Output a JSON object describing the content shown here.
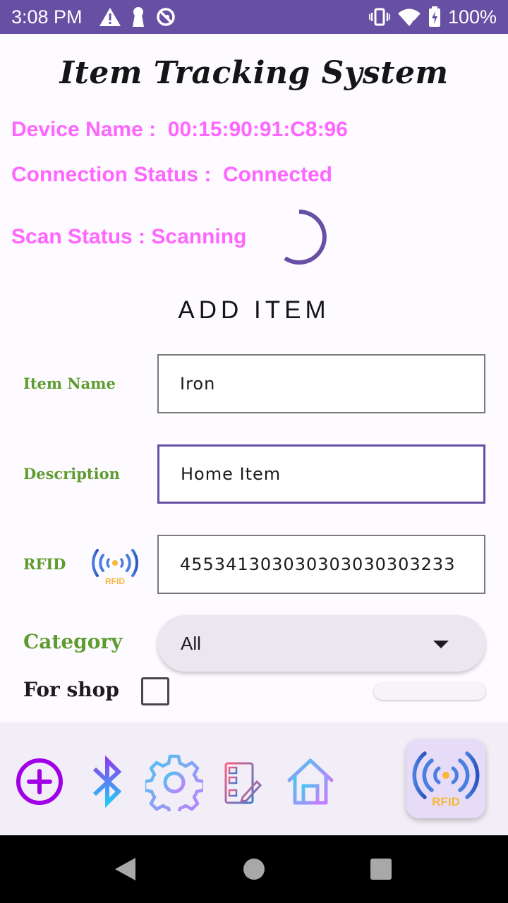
{
  "status_bar": {
    "time": "3:08 PM",
    "battery": "100%",
    "left_icons": [
      "warning-icon",
      "keyhole-icon",
      "sync-off-icon"
    ],
    "right_icons": [
      "vibrate-icon",
      "wifi-icon",
      "battery-icon"
    ]
  },
  "header": {
    "title": "Item Tracking System"
  },
  "device": {
    "name_line": "Device Name :  00:15:90:91:C8:96",
    "connection_line": "Connection Status :  Connected",
    "scan_line": "Scan Status : Scanning"
  },
  "form": {
    "section_title": "ADD ITEM",
    "item_name_label": "Item Name",
    "item_name_value": "Iron",
    "description_label": "Description",
    "description_value": "Home Item",
    "rfid_label": "RFID",
    "rfid_value": "455341303030303030303233",
    "category_label": "Category",
    "category_value": "All",
    "for_shop_label": "For shop",
    "for_shop_checked": false
  },
  "icon_text": {
    "rfid": "RFID"
  },
  "toolbar": {
    "icons": [
      "add-icon",
      "bluetooth-icon",
      "settings-icon",
      "report-icon",
      "home-icon",
      "rfid-scan-icon"
    ]
  },
  "colors": {
    "status_bar": "#6750a4",
    "accent_pink": "#ff66ff",
    "label_green": "#5f9c2f",
    "focus_purple": "#6750a4"
  }
}
